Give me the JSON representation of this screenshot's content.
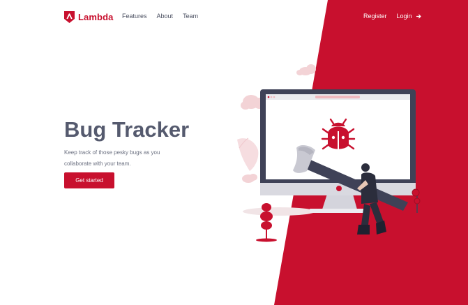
{
  "colors": {
    "brand": "#c8102e",
    "title": "#555a6e",
    "text": "#6b7080",
    "background": "#ffffff"
  },
  "nav": {
    "brand_name": "Lambda",
    "links": [
      "Features",
      "About",
      "Team"
    ],
    "register_label": "Register",
    "login_label": "Login"
  },
  "hero": {
    "title": "Bug Tracker",
    "description": "Keep track of those pesky bugs as you collaborate with your team.",
    "cta_label": "Get started"
  },
  "icons": {
    "logo": "lambda-logo-icon",
    "login": "arrow-right-icon",
    "bug": "bug-icon"
  }
}
